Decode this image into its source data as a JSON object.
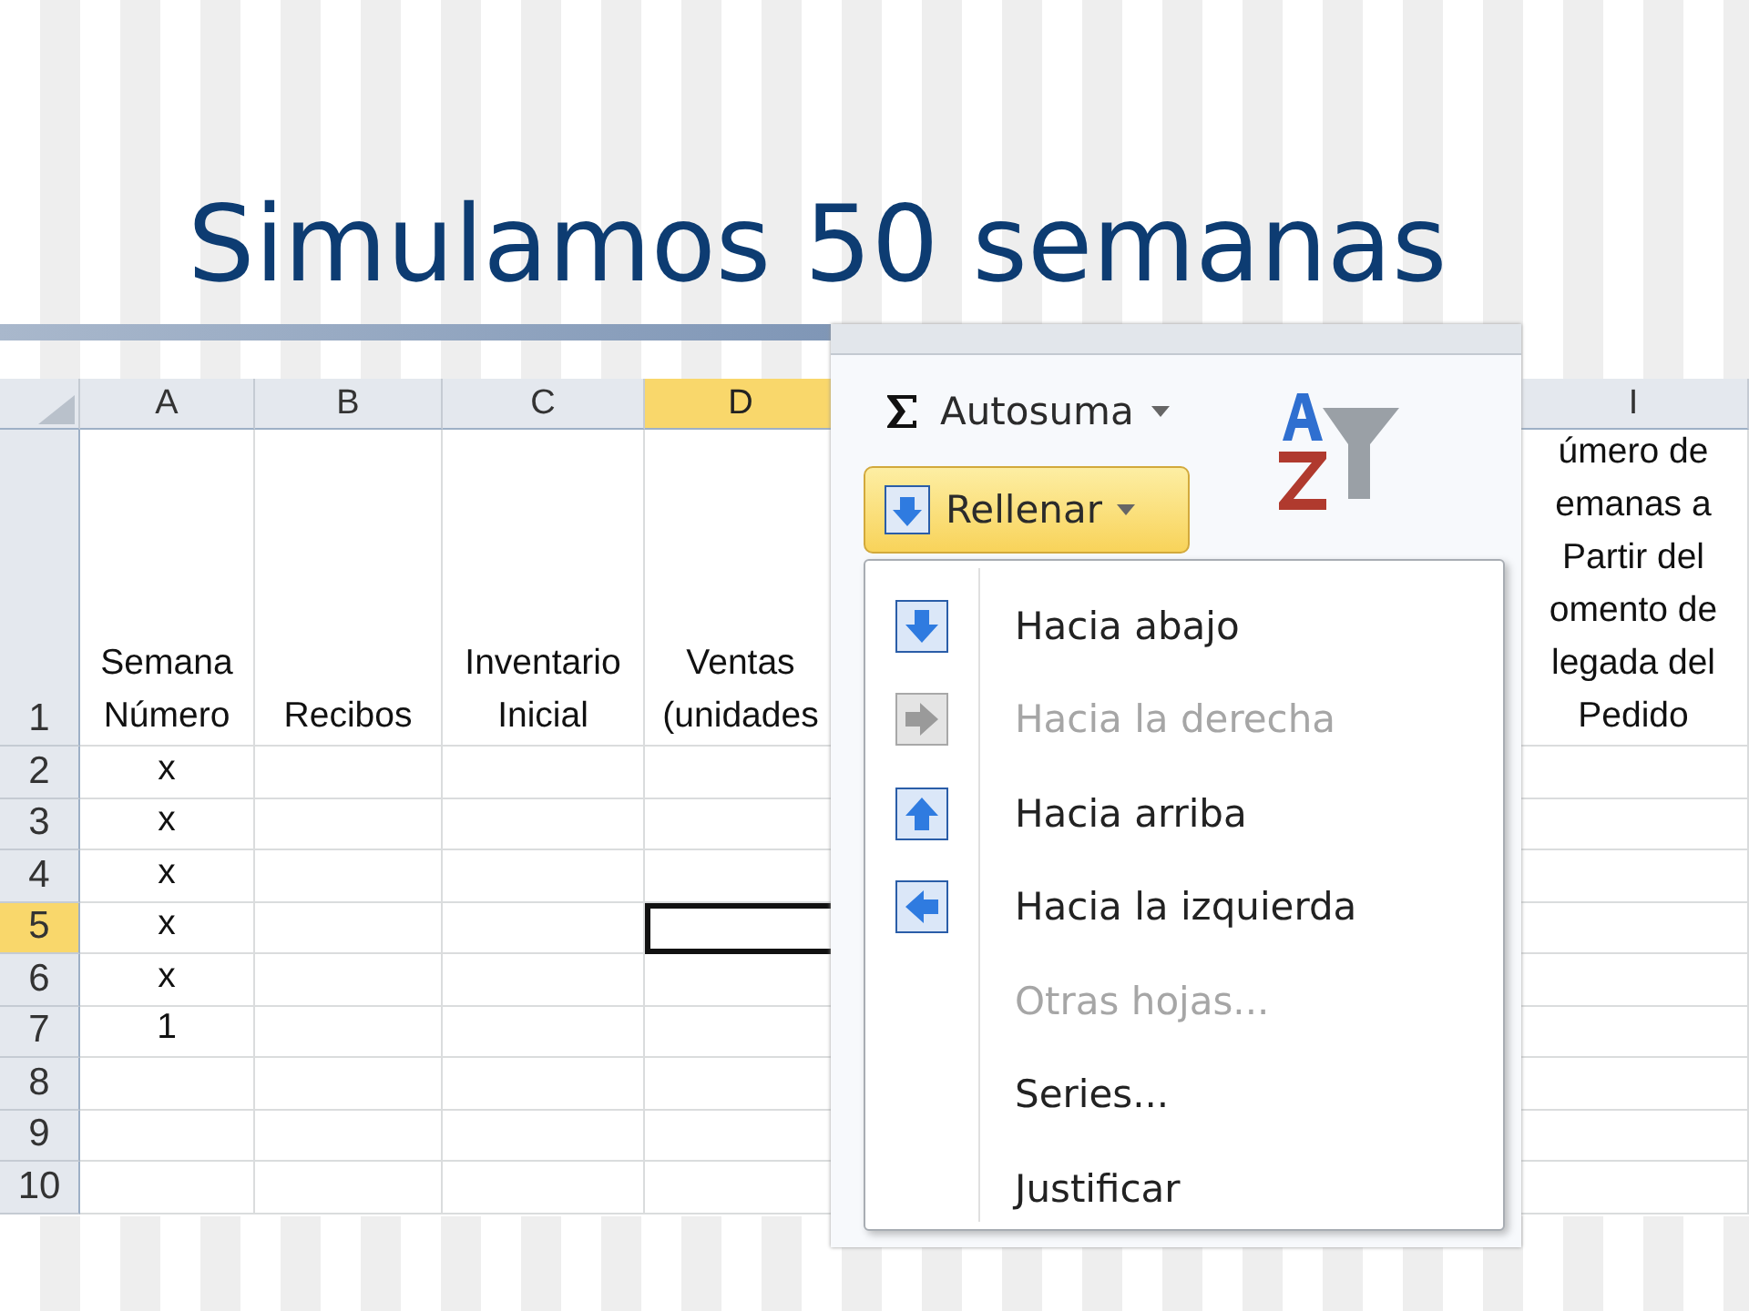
{
  "slide": {
    "title": "Simulamos 50 semanas"
  },
  "sheet": {
    "columns": [
      {
        "label": "A",
        "selected": false
      },
      {
        "label": "B",
        "selected": false
      },
      {
        "label": "C",
        "selected": false
      },
      {
        "label": "D",
        "selected": true
      },
      {
        "label": "I",
        "selected": false
      }
    ],
    "rows": [
      {
        "number": "1",
        "selected": false,
        "cells": [
          "Semana\nNúmero",
          "Recibos",
          "Inventario\nInicial",
          "Ventas\n(unidades",
          "úmero de\nemanas a\nPartir del\nomento de\nlegada del\nPedido"
        ]
      },
      {
        "number": "2",
        "selected": false,
        "cells": [
          "x",
          null,
          null,
          null,
          null
        ]
      },
      {
        "number": "3",
        "selected": false,
        "cells": [
          "x",
          null,
          null,
          null,
          null
        ]
      },
      {
        "number": "4",
        "selected": false,
        "cells": [
          "x",
          null,
          null,
          null,
          null
        ]
      },
      {
        "number": "5",
        "selected": true,
        "cells": [
          "x",
          null,
          null,
          null,
          null
        ]
      },
      {
        "number": "6",
        "selected": false,
        "cells": [
          "x",
          null,
          null,
          null,
          null
        ]
      },
      {
        "number": "7",
        "selected": false,
        "cells": [
          "1",
          null,
          null,
          null,
          null
        ]
      },
      {
        "number": "8",
        "selected": false,
        "cells": [
          null,
          null,
          null,
          null,
          null
        ]
      },
      {
        "number": "9",
        "selected": false,
        "cells": [
          null,
          null,
          null,
          null,
          null
        ]
      },
      {
        "number": "10",
        "selected": false,
        "cells": [
          null,
          null,
          null,
          null,
          null
        ]
      }
    ]
  },
  "ribbon": {
    "autosum": {
      "label": "Autosuma"
    },
    "fill_button": {
      "label": "Rellenar",
      "selected": true
    },
    "menu": [
      {
        "label": "Hacia abajo",
        "kind": "down",
        "disabled": false
      },
      {
        "label": "Hacia la derecha",
        "kind": "right",
        "disabled": true
      },
      {
        "label": "Hacia arriba",
        "kind": "up",
        "disabled": false
      },
      {
        "label": "Hacia la izquierda",
        "kind": "left",
        "disabled": false
      },
      {
        "label": "Otras hojas...",
        "kind": "plain",
        "disabled": true
      },
      {
        "label": "Series...",
        "kind": "plain",
        "disabled": false
      },
      {
        "label": "Justificar",
        "kind": "plain",
        "disabled": false
      }
    ]
  }
}
